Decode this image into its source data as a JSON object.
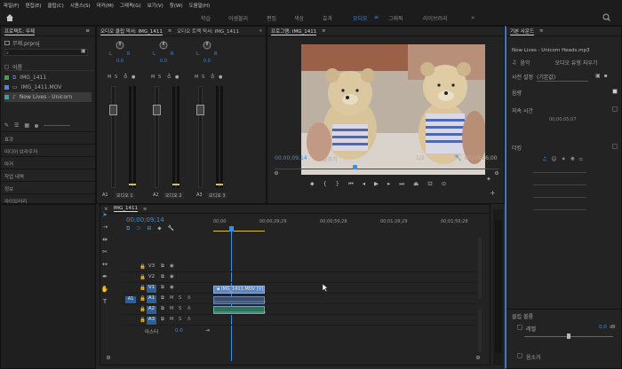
{
  "menu": [
    "파일(F)",
    "편집(E)",
    "클립(C)",
    "시퀀스(S)",
    "마커(M)",
    "그래픽(G)",
    "보기(V)",
    "창(W)",
    "도움말(H)"
  ],
  "workspaces": [
    "학습",
    "어셈블리",
    "편집",
    "색상",
    "효과",
    "오디오",
    "그래픽",
    "라이브러리"
  ],
  "active_workspace": "오디오",
  "project": {
    "title": "프로젝트: 무제",
    "file": "무제.prproj",
    "column": "이름",
    "items": [
      "IMG_1411",
      "IMG_1411.MOV",
      "Now Lives - Unicorn H"
    ],
    "item_colors": [
      "#3ea43e",
      "#5e7fd0",
      "#2ba8a8"
    ]
  },
  "side_list": [
    "효과",
    "미디어 브라우저",
    "마커",
    "작업 내역",
    "정보",
    "라이브러리"
  ],
  "mixer": {
    "tab1": "오디오 클립 믹서: IMG_1411",
    "tab2": "오디오 트랙 믹서: IMG_1411",
    "lr_labels": [
      "L",
      "R",
      "L",
      "R",
      "L",
      "R"
    ],
    "values": [
      "0.0",
      "0.0",
      "0.0"
    ],
    "tracks": [
      "A1",
      "A2",
      "A3"
    ],
    "track_names": [
      "오디오 1",
      "오디오 2",
      "오디오 3"
    ],
    "ms": [
      "M",
      "S"
    ]
  },
  "program": {
    "tab": "프로그램: IMG_1411",
    "timecode": "00;00;09;14",
    "fit": "맞추기",
    "quality": "1/2",
    "duration": "00;00;26;00"
  },
  "essential": {
    "title": "기본 사운드",
    "clip": "Now Lives - Unicorn Heads.mp3",
    "tab_music": "음악",
    "tab_type": "오디오 유형 지우기",
    "preset_label": "사전 설정",
    "preset_value": "(기본값)",
    "loudness": "음량",
    "duration": "지속 시간",
    "duration_val": "00;00;05;07",
    "ducking": "더킹",
    "clip_volume": "클립 볼륨",
    "level": "레벨",
    "level_val": "0.0",
    "mute": "음소거",
    "db": "dB"
  },
  "timeline": {
    "tab": "IMG_1411",
    "timecode": "00;00;09;14",
    "ruler": [
      "00;00",
      "00;00;29;29",
      "00;00;59;28",
      "00;01;29;29",
      "00;01;59;28"
    ],
    "video_tracks": [
      "V3",
      "V2",
      "V1"
    ],
    "audio_tracks": [
      "A1",
      "A2",
      "A3"
    ],
    "src_a1": "A1",
    "master": "마스터",
    "master_val": "0.0",
    "clip_v": "IMG_1411.MOV [V]",
    "btn_m": "M",
    "btn_s": "S"
  }
}
